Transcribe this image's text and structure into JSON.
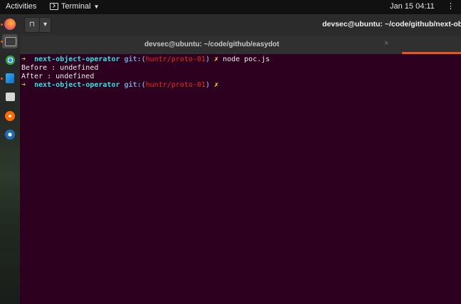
{
  "topbar": {
    "activities": "Activities",
    "app_name": "Terminal",
    "clock": "Jan 15  04:11",
    "colors": {
      "bg": "#111111",
      "text": "#e6e6e6"
    }
  },
  "dock": {
    "items": [
      {
        "name": "firefox-icon",
        "color": "#e66000"
      },
      {
        "name": "terminal-icon",
        "active": true
      },
      {
        "name": "chrome-icon",
        "color": "#4285f4"
      },
      {
        "name": "vscode-icon",
        "color": "#1e88e5"
      },
      {
        "name": "files-icon",
        "color": "#d8d8d8"
      },
      {
        "name": "burp-icon",
        "color": "#ff6a00"
      },
      {
        "name": "wireshark-icon",
        "color": "#1f6cb3"
      }
    ]
  },
  "window": {
    "title": "devsec@ubuntu: ~/code/github/next-objec",
    "tab_title": "devsec@ubuntu: ~/code/github/easydot",
    "tab_close": "×",
    "accent": "#e95420"
  },
  "terminal": {
    "background": "#2c001e",
    "prompt": {
      "arrow": "➜",
      "dir": "next-object-operator",
      "git_prefix": "git:(",
      "branch": "huntr/proto-01",
      "git_suffix": ")",
      "dirty": "✗"
    },
    "command": "node poc.js",
    "output": [
      "Before : undefined",
      "After : undefined"
    ]
  }
}
